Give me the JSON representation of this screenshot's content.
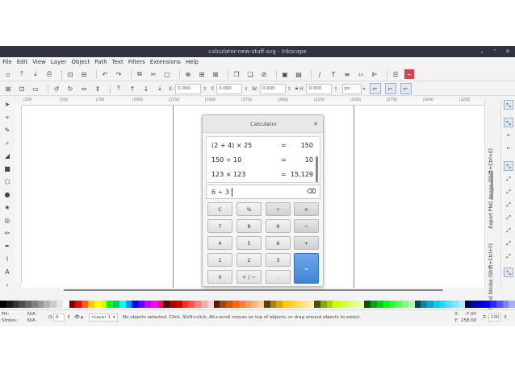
{
  "window": {
    "title": "calculator-new-stuff.svg - Inkscape"
  },
  "menubar": [
    "File",
    "Edit",
    "View",
    "Layer",
    "Object",
    "Path",
    "Text",
    "Filters",
    "Extensions",
    "Help"
  ],
  "toolbar2": {
    "x_label": "X:",
    "x_value": "0.000",
    "y_label": "Y:",
    "y_value": "0.000",
    "w_label": "W:",
    "w_value": "0.000",
    "h_label": "H:",
    "h_value": "0.000",
    "unit": "px"
  },
  "ruler_ticks": [
    "|250",
    "|500",
    "|750",
    "|1000",
    "|1250",
    "|1500",
    "|1750",
    "|2000",
    "|2250",
    "|2500",
    "|2750",
    "|3000",
    "|3250"
  ],
  "dock": {
    "tab_export": "Export PNG Image (Shift+Ctrl+E)",
    "tab_fill": "Fill and Stroke (Shift+Ctrl+F)"
  },
  "status": {
    "fill_label": "Fill:",
    "fill_value": "N/A",
    "stroke_label": "Stroke:",
    "stroke_value": "N/A",
    "opacity_label": "O:",
    "opacity_value": "0",
    "layer": "•Layer 1",
    "message": "No objects selected. Click, Shift+click, Alt+scroll mouse on top of objects, or drag around objects to select.",
    "x_coord": "X:    -7.00",
    "y_coord": "Y:  258.00",
    "zoom_label": "Z:",
    "zoom_value": "100"
  },
  "calculator": {
    "title": "Calculator",
    "history": [
      {
        "expr": "(2 + 4) × 25",
        "eq": "=",
        "val": "150"
      },
      {
        "expr": "150 ÷ 10",
        "eq": "=",
        "val": "10"
      },
      {
        "expr": "123 × 123",
        "eq": "=",
        "val": "15,129"
      }
    ],
    "entry": "6 ÷ 3",
    "keys": {
      "clear": "C",
      "percent": "%",
      "divide": "÷",
      "multiply": "×",
      "seven": "7",
      "eight": "8",
      "nine": "9",
      "minus": "−",
      "four": "4",
      "five": "5",
      "six": "6",
      "plus": "+",
      "one": "1",
      "two": "2",
      "three": "3",
      "equals": "=",
      "zero": "0",
      "plusminus": "+ / −",
      "decimal": "."
    }
  },
  "colors": {
    "titlebar": "#2f343f",
    "accent": "#3d84d6"
  },
  "palette": [
    "#000000",
    "#1a1a1a",
    "#333333",
    "#4d4d4d",
    "#666666",
    "#808080",
    "#999999",
    "#b3b3b3",
    "#cccccc",
    "#e6e6e6",
    "#ffffff",
    "#800000",
    "#ff0000",
    "#ff6600",
    "#ffcc00",
    "#ffff00",
    "#ccff00",
    "#00ff00",
    "#00cc66",
    "#00ffff",
    "#0099ff",
    "#0000ff",
    "#6600ff",
    "#cc00ff",
    "#ff00ff",
    "#ff0066",
    "#550000",
    "#aa0000",
    "#d40000",
    "#ff2a2a",
    "#ff5555",
    "#ff8080",
    "#ffaaaa",
    "#ffd5d5",
    "#552200",
    "#aa4400",
    "#d45500",
    "#ff6600",
    "#ff7f2a",
    "#ff9955",
    "#ffb380",
    "#ffccaa",
    "#554400",
    "#aa8800",
    "#d4aa00",
    "#ffcc00",
    "#ffd42a",
    "#ffdd55",
    "#ffe680",
    "#ffeeaa",
    "#445500",
    "#88aa00",
    "#aad400",
    "#ccff00",
    "#d4ff2a",
    "#ddff55",
    "#e5ff80",
    "#eeffaa",
    "#005500",
    "#00aa00",
    "#00d400",
    "#00ff00",
    "#2aff2a",
    "#55ff55",
    "#80ff80",
    "#aaffaa",
    "#004455",
    "#0088aa",
    "#00aad4",
    "#00ccff",
    "#2ad4ff",
    "#55ddff",
    "#80e5ff",
    "#aaeeff",
    "#000055",
    "#0000aa",
    "#0000d4",
    "#0000ff",
    "#2a2aff",
    "#5555ff",
    "#8080ff",
    "#aaaaff"
  ]
}
